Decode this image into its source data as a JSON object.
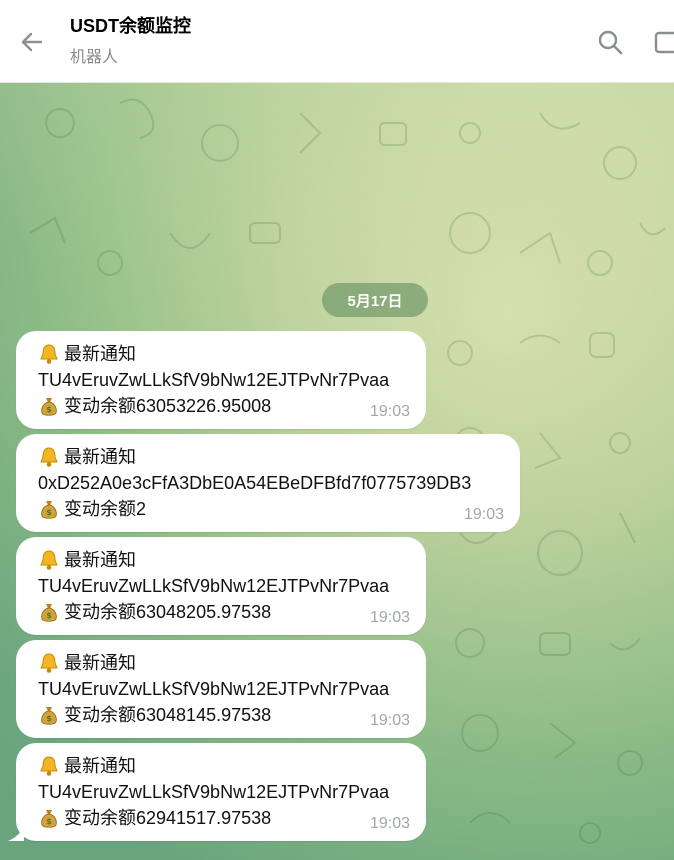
{
  "header": {
    "title": "USDT余额监控",
    "subtitle": "机器人",
    "back_icon": "back-arrow-icon",
    "search_icon": "search-icon"
  },
  "chat": {
    "date_label": "5月17日",
    "messages": [
      {
        "title": "最新通知",
        "address": "TU4vEruvZwLLkSfV9bNw12EJTPvNr7Pvaa",
        "change": "变动余额63053226.95008",
        "time": "19:03"
      },
      {
        "title": "最新通知",
        "address": "0xD252A0e3cFfA3DbE0A54EBeDFBfd7f0775739DB3",
        "change": "变动余额2",
        "time": "19:03"
      },
      {
        "title": "最新通知",
        "address": "TU4vEruvZwLLkSfV9bNw12EJTPvNr7Pvaa",
        "change": "变动余额63048205.97538",
        "time": "19:03"
      },
      {
        "title": "最新通知",
        "address": "TU4vEruvZwLLkSfV9bNw12EJTPvNr7Pvaa",
        "change": "变动余额63048145.97538",
        "time": "19:03"
      },
      {
        "title": "最新通知",
        "address": "TU4vEruvZwLLkSfV9bNw12EJTPvNr7Pvaa",
        "change": "变动余额62941517.97538",
        "time": "19:03"
      }
    ]
  },
  "colors": {
    "bubble": "#ffffff",
    "time": "#a0a7ad",
    "date_pill": "#6e9a6c"
  },
  "icons": {
    "bell": "bell-icon",
    "money_bag": "money-bag-icon"
  }
}
